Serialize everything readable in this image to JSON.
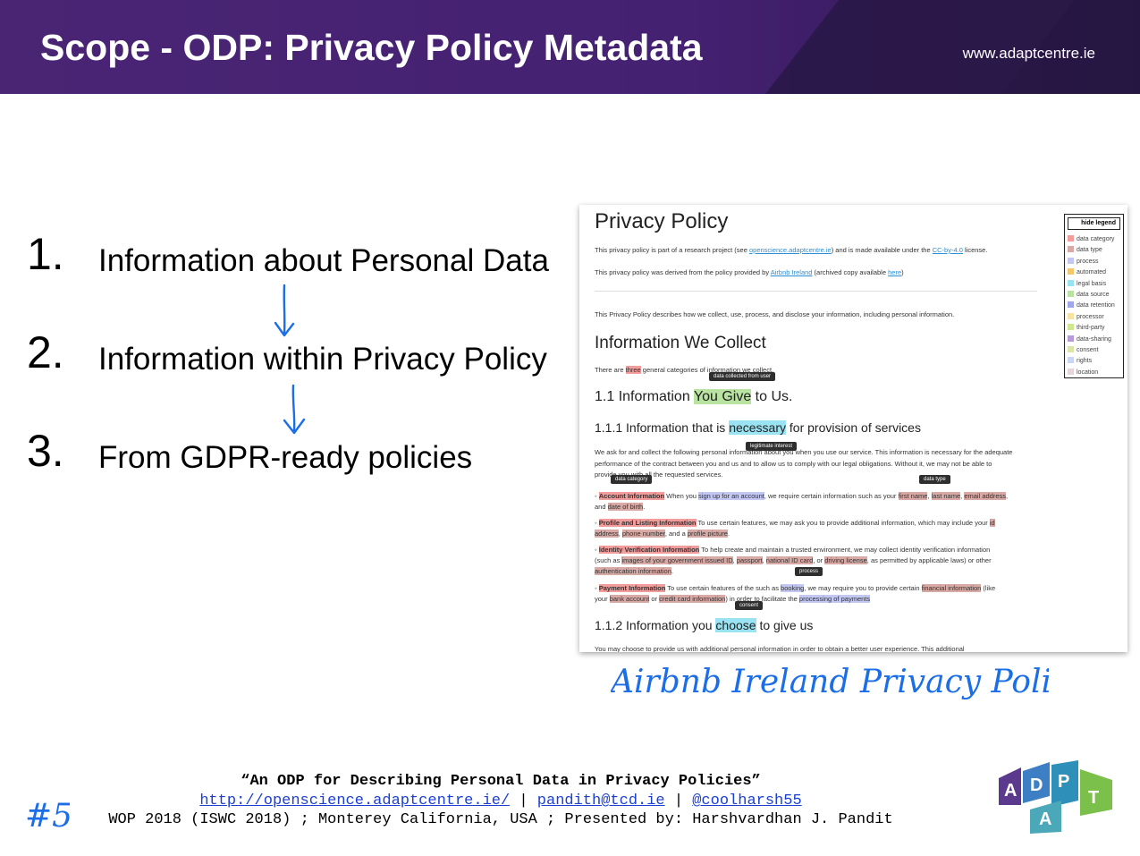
{
  "header": {
    "title": "Scope - ODP: Privacy Policy Metadata",
    "site": "www.adaptcentre.ie",
    "colors": {
      "band": "#452172",
      "text": "#ffffff"
    }
  },
  "list": [
    {
      "number": "1.",
      "text": "Information about Personal Data"
    },
    {
      "number": "2.",
      "text": "Information within Privacy Policy"
    },
    {
      "number": "3.",
      "text": "From GDPR-ready policies"
    }
  ],
  "screenshot": {
    "title": "Privacy Policy",
    "intro1": {
      "pre": "This privacy policy is part of a research project (see ",
      "link": "openscience.adaptcentre.ie",
      "mid": ") and is made available under the ",
      "link2": "CC-by-4.0",
      "post": " license."
    },
    "intro2": {
      "pre": "This privacy policy was derived from the policy provided by ",
      "link": "Airbnb Ireland",
      "mid": " (archived copy available ",
      "link2": "here",
      "post": ")"
    },
    "describes": "This Privacy Policy describes how we collect, use, process, and disclose your information, including personal information.",
    "collect_heading": "Information We Collect",
    "collect_line": {
      "pre": "There are ",
      "hl": "three",
      "post": " general categories of information we collect."
    },
    "tip_collected": "data collected from user",
    "h_11": {
      "pre": "1.1 Information ",
      "hl": "You Give",
      "post": " to Us."
    },
    "h_111": {
      "pre": "1.1.1 Information that is ",
      "hl": "necessary",
      "post": " for provision of services"
    },
    "tip_legit": "legitimate interest",
    "para_111a": "We ask for and collect the following personal information about you when you use our service. This information is necessary for the adequate",
    "para_111b": "performance of the contract between you and us and to allow us to comply with our legal obligations. Without it, we may not be able to",
    "para_111c": "provide you with all the requested services.",
    "tip_category": "data category",
    "tip_type": "data type",
    "account": {
      "label": "Account Information",
      "t1": " When you ",
      "hl1": "sign up for an account",
      "t2": ", we require certain information such as your ",
      "hl2": "first name",
      "t3": ", ",
      "hl3": "last name",
      "t4": ", ",
      "hl4": "email address",
      "t5": ",",
      "line2pre": "and ",
      "hl5": "date of birth",
      "line2post": "."
    },
    "profile": {
      "label": "Profile and Listing Information",
      "t1": " To use certain features, we may ask you to provide additional information, which may include your ",
      "hl1": "id",
      "hl2": "address",
      "t2": ", ",
      "hl3": "phone number",
      "t3": ", and a ",
      "hl4": "profile picture",
      "t4": "."
    },
    "identity": {
      "label": "Identity Verification Information",
      "t1": " To help create and maintain a trusted environment, we may collect identity verification information",
      "t2": "(such as ",
      "hl1": "images of your government issued ID",
      "t3": ", ",
      "hl2": "passport",
      "t4": ", ",
      "hl3": "national ID card",
      "t5": ", or ",
      "hl4": "driving license",
      "t6": ", as permitted by applicable laws) or other",
      "hl5": "authentication information",
      "t7": "."
    },
    "tip_process": "process",
    "payment": {
      "label": "Payment Information",
      "t1": " To use certain features of the such as ",
      "hl1": "booking",
      "t2": ", we may require you to provide certain ",
      "hl2": "financial information",
      "t3": " (like",
      "t4": "your ",
      "hl3": "bank account",
      "t5": " or ",
      "hl4": "credit card information",
      "t6": ") in order to facilitate the ",
      "hl5": "processing of payments"
    },
    "tip_consent": "consent",
    "h_112": {
      "pre": "1.1.2 Information you ",
      "hl": "choose",
      "post": " to give us"
    },
    "para_112": "You may choose to provide us with additional personal information in order to obtain a better user experience. This additional",
    "legend": {
      "button": "hide legend",
      "items": [
        {
          "label": "data category",
          "color": "#f29c9c"
        },
        {
          "label": "data type",
          "color": "#d9aaa5"
        },
        {
          "label": "process",
          "color": "#c3c8f3"
        },
        {
          "label": "automated",
          "color": "#f5c76b"
        },
        {
          "label": "legal basis",
          "color": "#9ae3f2"
        },
        {
          "label": "data source",
          "color": "#b8e3a0"
        },
        {
          "label": "data retention",
          "color": "#9fa9ea"
        },
        {
          "label": "processor",
          "color": "#f7e3a0"
        },
        {
          "label": "third-party",
          "color": "#cfe88f"
        },
        {
          "label": "data-sharing",
          "color": "#b99ad9"
        },
        {
          "label": "consent",
          "color": "#dce6a8"
        },
        {
          "label": "rights",
          "color": "#c9d6f5"
        },
        {
          "label": "location",
          "color": "#e6d6dc"
        }
      ]
    }
  },
  "handwritten_caption": "Airbnb Ireland Privacy Policy",
  "handwritten_number": "#5",
  "footer": {
    "quote": "“An ODP for Describing Personal Data in Privacy Policies”",
    "link1": "http://openscience.adaptcentre.ie/",
    "sep": " | ",
    "link2": "pandith@tcd.ie",
    "link3": "@coolharsh55",
    "line3": "WOP 2018 (ISWC 2018) ; Monterey California, USA ; Presented by: Harshvardhan J. Pandit"
  },
  "logo": {
    "letters": [
      "A",
      "D",
      "P",
      "A",
      "T"
    ]
  }
}
